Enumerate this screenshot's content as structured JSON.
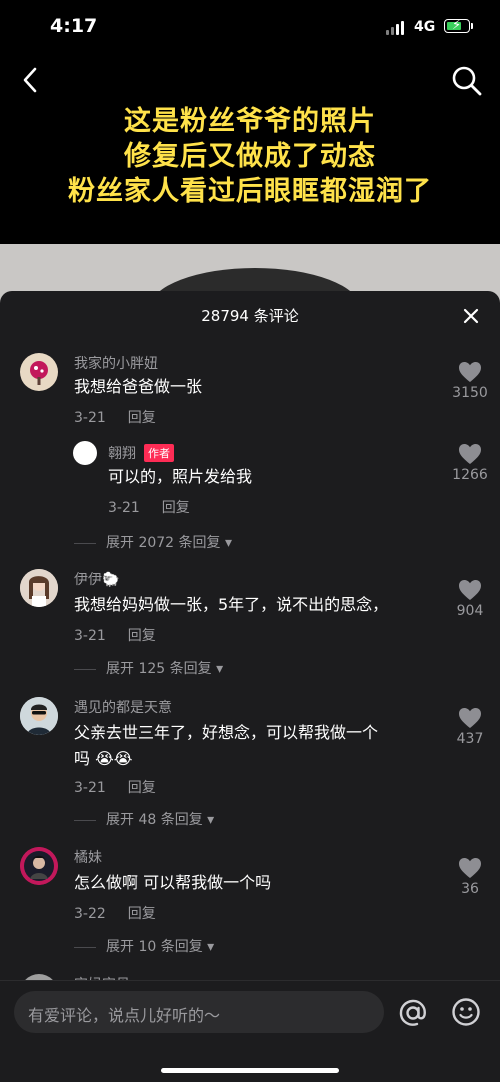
{
  "status_bar": {
    "time": "4:17",
    "network": "4G"
  },
  "video": {
    "caption_lines": [
      "这是粉丝爷爷的照片",
      "修复后又做成了动态",
      "粉丝家人看过后眼眶都湿润了"
    ]
  },
  "comments_panel": {
    "title": "28794 条评论",
    "comments": [
      {
        "name": "我家的小胖妞",
        "text": "我想给爸爸做一张",
        "date": "3-21",
        "reply_label": "回复",
        "likes": "3150"
      },
      {
        "name": "翱翔",
        "tag": "作者",
        "text": "可以的，照片发给我",
        "date": "3-21",
        "reply_label": "回复",
        "likes": "1266"
      },
      {
        "expand": "展开 2072 条回复"
      },
      {
        "name": "伊伊🐑",
        "text": "我想给妈妈做一张，5年了，说不出的思念，",
        "date": "3-21",
        "reply_label": "回复",
        "likes": "904"
      },
      {
        "expand": "展开 125 条回复"
      },
      {
        "name": "遇见的都是天意",
        "text_line1": "父亲去世三年了，好想念，可以帮我做一个",
        "text_line2": "吗 😭😭",
        "date": "3-21",
        "reply_label": "回复",
        "likes": "437"
      },
      {
        "expand": "展开 48 条回复"
      },
      {
        "name": "橘妹",
        "text": "怎么做啊 可以帮我做一个吗",
        "date": "3-22",
        "reply_label": "回复",
        "likes": "36"
      },
      {
        "expand": "展开 10 条回复"
      },
      {
        "name": "宝妈宝贝"
      }
    ]
  },
  "input": {
    "placeholder": "有爱评论，说点儿好听的～"
  },
  "icons": {
    "back": "chevron-left-icon",
    "search": "search-icon",
    "close": "close-icon",
    "like": "heart-icon",
    "at": "at-sign-icon",
    "emoji": "smiley-icon"
  },
  "colors": {
    "caption": "#ffe24a",
    "author_tag": "#fe2c55",
    "battery": "#3ad05c"
  },
  "battery_level": 0.75
}
